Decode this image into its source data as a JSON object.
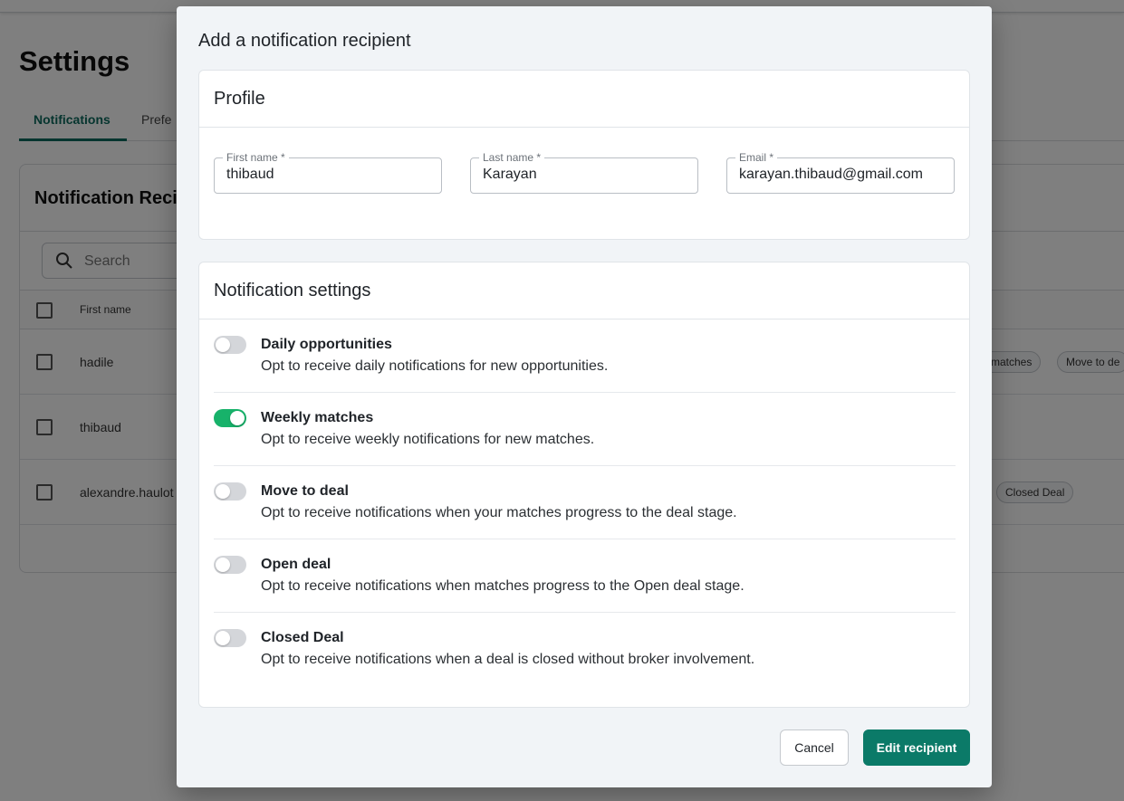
{
  "background": {
    "page_title": "Settings",
    "tabs": [
      {
        "label": "Notifications"
      },
      {
        "label": "Prefe"
      }
    ],
    "card_title": "Notification Reci",
    "search_placeholder": "Search",
    "column_first_name": "First name",
    "rows": [
      {
        "first_name": "hadile",
        "chips": [
          "matches",
          "Move to de"
        ]
      },
      {
        "first_name": "thibaud",
        "chips": []
      },
      {
        "first_name": "alexandre.haulot",
        "chips": [
          "Closed Deal"
        ]
      }
    ]
  },
  "modal": {
    "title": "Add a notification recipient",
    "profile": {
      "heading": "Profile",
      "first_name": {
        "label": "First name *",
        "value": "thibaud"
      },
      "last_name": {
        "label": "Last name *",
        "value": "Karayan"
      },
      "email": {
        "label": "Email *",
        "value": "karayan.thibaud@gmail.com"
      }
    },
    "notifications": {
      "heading": "Notification settings",
      "items": [
        {
          "title": "Daily opportunities",
          "description": "Opt to receive daily notifications for new opportunities.",
          "enabled": false
        },
        {
          "title": "Weekly matches",
          "description": "Opt to receive weekly notifications for new matches.",
          "enabled": true
        },
        {
          "title": "Move to deal",
          "description": "Opt to receive notifications when your matches progress to the deal stage.",
          "enabled": false
        },
        {
          "title": "Open deal",
          "description": "Opt to receive notifications when matches progress to the Open deal stage.",
          "enabled": false
        },
        {
          "title": "Closed Deal",
          "description": "Opt to receive notifications when a deal is closed without broker involvement.",
          "enabled": false
        }
      ]
    },
    "buttons": {
      "cancel": "Cancel",
      "submit": "Edit recipient"
    }
  },
  "colors": {
    "accent": "#0b7a68",
    "toggle_on": "#17b26a",
    "toggle_off": "#d4d6da"
  }
}
